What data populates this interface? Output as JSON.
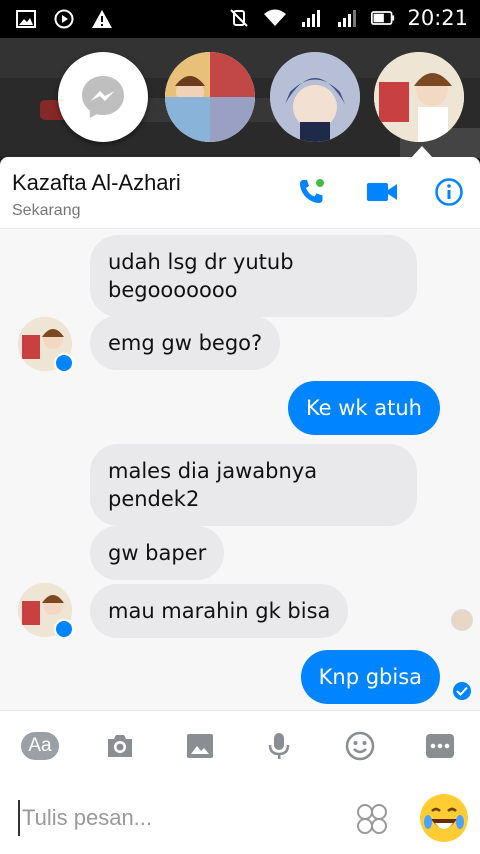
{
  "status_bar": {
    "time": "20:21",
    "icons": [
      "gallery-icon",
      "play-icon",
      "alert-icon",
      "mute-icon",
      "wifi-icon",
      "signal-icon",
      "signal-2-icon",
      "battery-icon"
    ]
  },
  "chat_heads": [
    "messenger-logo",
    "contact-1",
    "contact-2",
    "contact-3"
  ],
  "header": {
    "contact_name": "Kazafta Al-Azhari",
    "status": "Sekarang",
    "actions": [
      "phone-icon",
      "video-icon",
      "info-icon"
    ]
  },
  "messages": [
    {
      "direction": "in",
      "text": "udah lsg dr yutub\nbegooooooo"
    },
    {
      "direction": "in",
      "text": "emg gw bego?"
    },
    {
      "direction": "out",
      "text": "Ke wk atuh"
    },
    {
      "direction": "in",
      "text": "males dia jawabnya\npendek2"
    },
    {
      "direction": "in",
      "text": "gw baper"
    },
    {
      "direction": "in",
      "text": "mau marahin gk bisa"
    },
    {
      "direction": "out",
      "text": "Knp gbisa"
    }
  ],
  "composer": {
    "aa_label": "Aa",
    "placeholder": "Tulis pesan...",
    "tools": [
      "text-format-icon",
      "camera-icon",
      "image-icon",
      "mic-icon",
      "emoji-icon",
      "more-icon"
    ]
  },
  "colors": {
    "accent": "#0084ff",
    "incoming_bubble": "#e9e9eb"
  }
}
